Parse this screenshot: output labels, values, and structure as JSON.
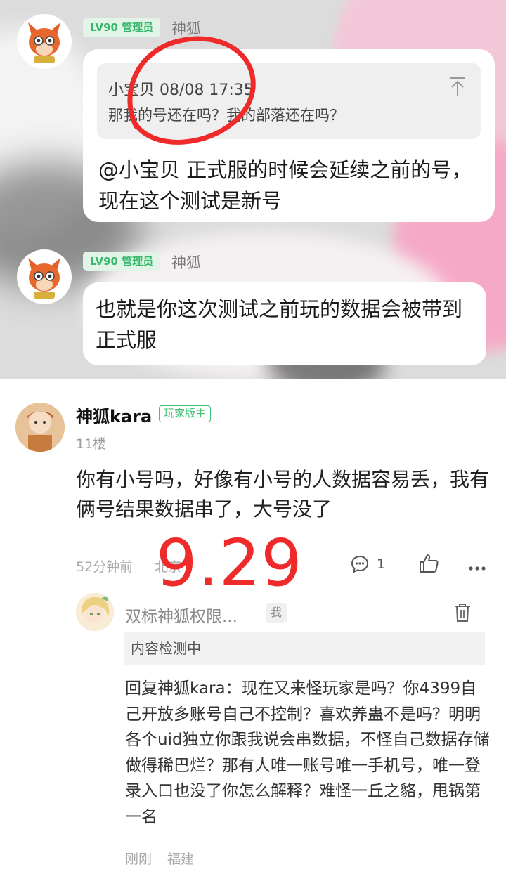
{
  "top_post": {
    "message1": {
      "level_badge": "LV90 管理员",
      "nickname": "神狐",
      "quote_header": "小宝贝 08/08 17:35",
      "quote_text": "那我的号还在吗？我的部落还在吗？",
      "text": "@小宝贝 正式服的时候会延续之前的号，现在这个测试是新号"
    },
    "message2": {
      "level_badge": "LV90 管理员",
      "nickname": "神狐",
      "text": "也就是你这次测试之前玩的数据会被带到正式服"
    }
  },
  "comment": {
    "author": "神狐kara",
    "author_tag": "玩家版主",
    "floor": "11楼",
    "text": "你有小号吗，好像有小号的人数据容易丢，我有俩号结果数据串了，大号没了",
    "time": "52分钟前",
    "location": "北京",
    "reply_count": "1",
    "overlay_number": "9.29",
    "reply": {
      "author": "双标神狐权限...",
      "me_tag": "我",
      "status": "内容检测中",
      "text": "回复神狐kara：现在又来怪玩家是吗？你4399自己开放多账号自己不控制？喜欢养蛊不是吗？明明各个uid独立你跟我说会串数据，不怪自己数据存储做得稀巴烂？那有人唯一账号唯一手机号，唯一登录入口也没了你怎么解释？难怪一丘之貉，甩锅第一名",
      "time": "刚刚",
      "location": "福建"
    }
  },
  "colors": {
    "accent_green": "#35b86a",
    "annotation_red": "#ee2a2a"
  }
}
